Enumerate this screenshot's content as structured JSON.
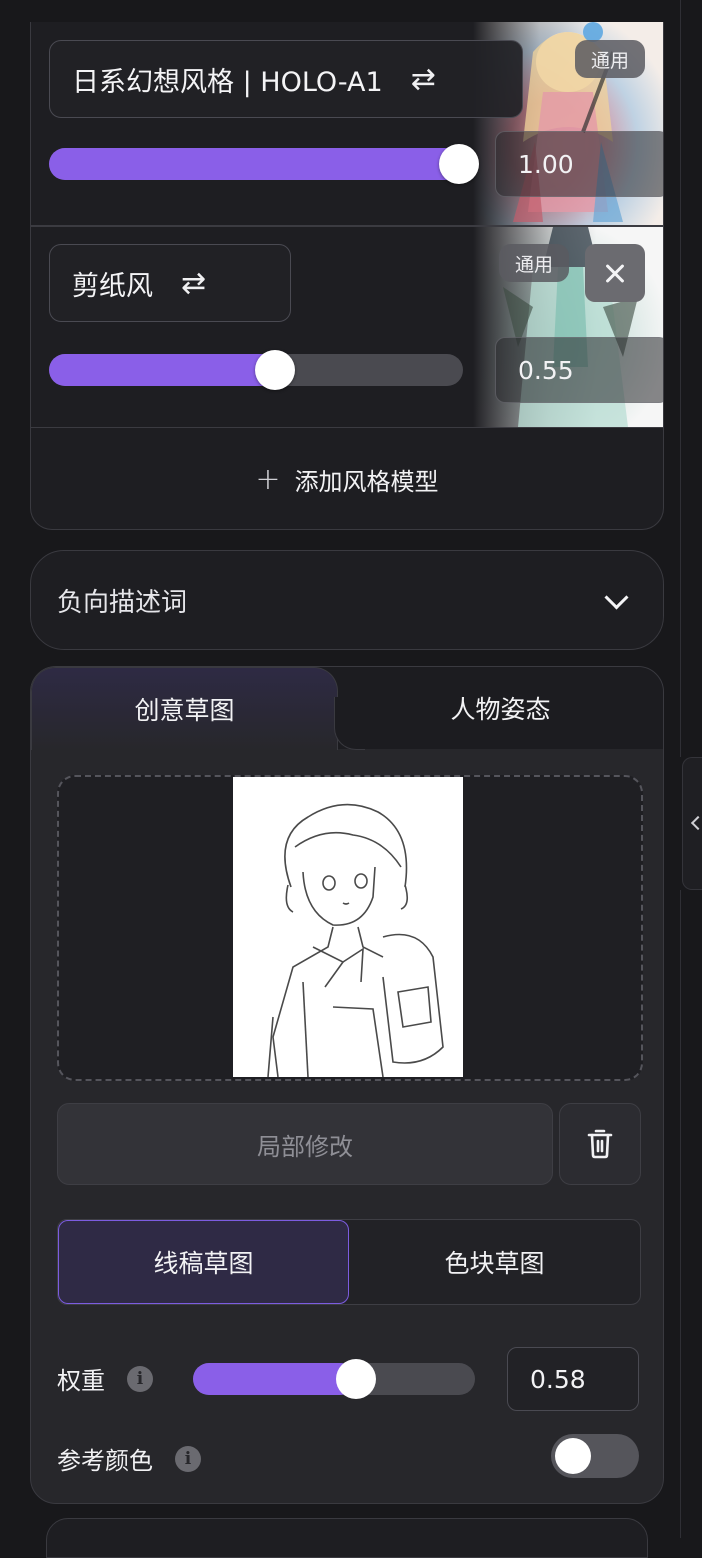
{
  "style_models": [
    {
      "name": "日系幻想风格 | HOLO-A1",
      "tag": "通用",
      "value": "1.00",
      "level": 1.0,
      "removable": false
    },
    {
      "name": "剪纸风",
      "tag": "通用",
      "value": "0.55",
      "level": 0.55,
      "removable": true
    }
  ],
  "add_style_label": "添加风格模型",
  "negative_prompt": {
    "label": "负向描述词"
  },
  "sketch": {
    "tabs": [
      "创意草图",
      "人物姿态"
    ],
    "active_tab": 0,
    "local_edit_label": "局部修改",
    "modes": [
      "线稿草图",
      "色块草图"
    ],
    "active_mode": 0,
    "weight": {
      "label": "权重",
      "value": "0.58",
      "level": 0.58
    },
    "ref_color": {
      "label": "参考颜色",
      "enabled": false
    }
  },
  "colors": {
    "accent": "#8a5fe8",
    "background": "#18181b",
    "panel": "#27272b"
  }
}
